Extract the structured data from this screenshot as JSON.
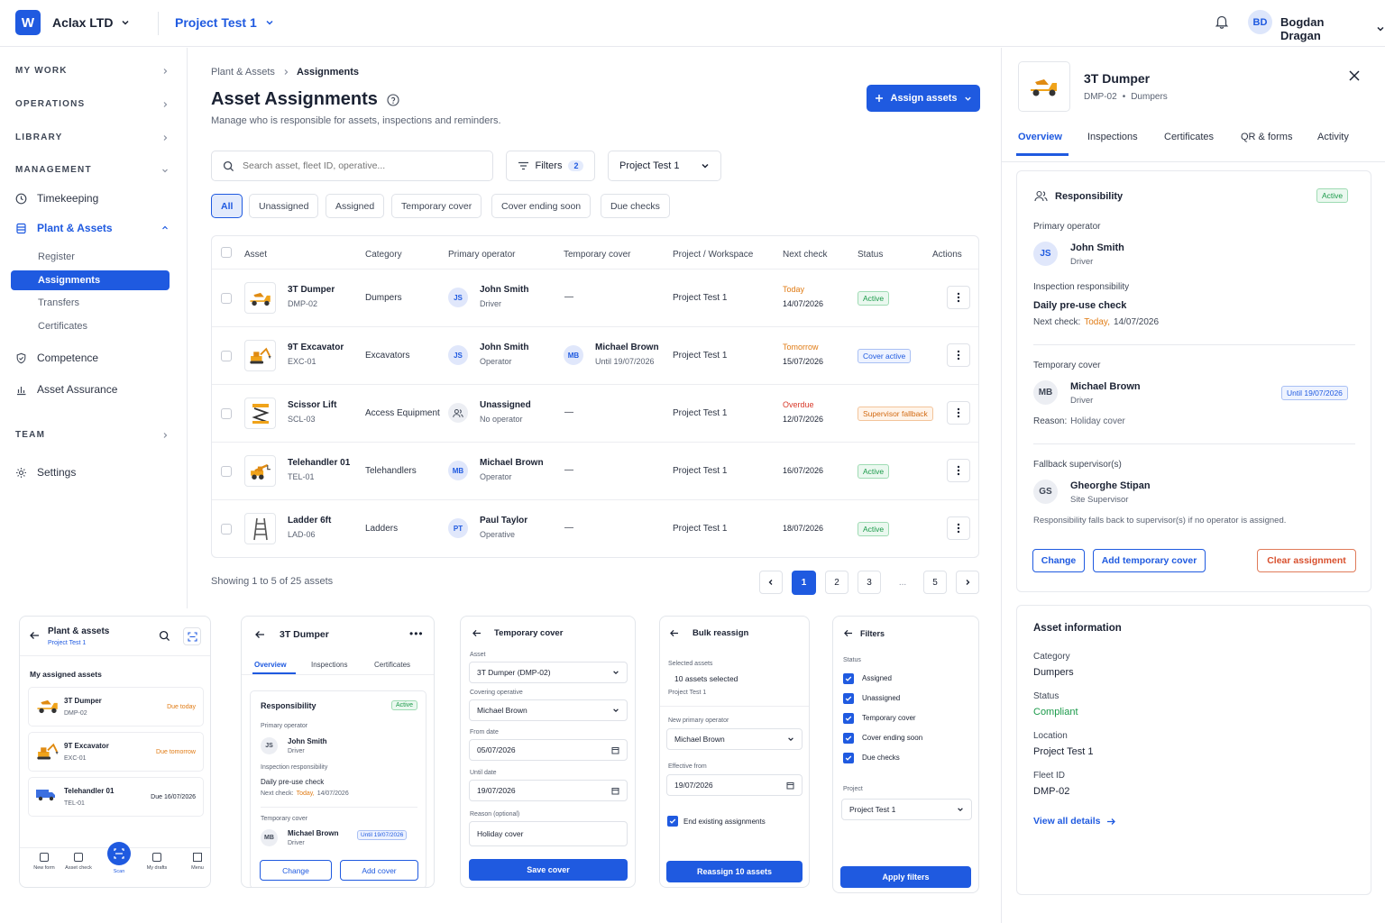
{
  "topbar": {
    "logo": "W",
    "org": "Aclax LTD",
    "project": "Project Test 1",
    "user_initials": "BD",
    "user_name": "Bogdan Dragan"
  },
  "sidebar": {
    "sections": {
      "my_work": "MY WORK",
      "operations": "OPERATIONS",
      "library": "LIBRARY",
      "management": "MANAGEMENT",
      "team": "TEAM"
    },
    "items": {
      "timekeeping": "Timekeeping",
      "plant": "Plant & Assets",
      "competence": "Competence",
      "assurance": "Asset Assurance",
      "settings": "Settings"
    },
    "subs": {
      "register": "Register",
      "assignments": "Assignments",
      "transfers": "Transfers",
      "certificates": "Certificates"
    }
  },
  "main": {
    "breadcrumb": {
      "parent": "Plant & Assets",
      "current": "Assignments"
    },
    "title": "Asset Assignments",
    "subtitle": "Manage who is responsible for assets, inspections and reminders.",
    "assign_btn": "Assign assets",
    "search_placeholder": "Search asset, fleet ID, operative...",
    "filters_label": "Filters",
    "filters_count": "2",
    "project_select": "Project Test 1",
    "chips": [
      "All",
      "Unassigned",
      "Assigned",
      "Temporary cover",
      "Cover ending soon",
      "Due checks"
    ],
    "columns": [
      "Asset",
      "Category",
      "Primary operator",
      "Temporary cover",
      "Project / Workspace",
      "Next check",
      "Status",
      "Actions"
    ],
    "rows": [
      {
        "name": "3T Dumper",
        "id": "DMP-02",
        "icon": "dumper-icon",
        "category": "Dumpers",
        "op_initials": "JS",
        "op_name": "John Smith",
        "op_role": "Driver",
        "cover": "—",
        "cover_initials": "",
        "cover_name": "",
        "cover_until": "",
        "project": "Project Test 1",
        "check_label": "Today",
        "check_color": "#e07b14",
        "check_date": "14/07/2026",
        "status": "Active",
        "status_kind": "green"
      },
      {
        "name": "9T Excavator",
        "id": "EXC-01",
        "icon": "excavator-icon",
        "category": "Excavators",
        "op_initials": "JS",
        "op_name": "John Smith",
        "op_role": "Operator",
        "cover": "",
        "cover_initials": "MB",
        "cover_name": "Michael Brown",
        "cover_until": "Until 19/07/2026",
        "project": "Project Test 1",
        "check_label": "Tomorrow",
        "check_color": "#e07b14",
        "check_date": "15/07/2026",
        "status": "Cover active",
        "status_kind": "blue"
      },
      {
        "name": "Scissor Lift",
        "id": "SCL-03",
        "icon": "scissor-lift-icon",
        "category": "Access Equipment",
        "op_initials": "",
        "op_name": "Unassigned",
        "op_role": "No operator",
        "cover": "—",
        "cover_initials": "",
        "cover_name": "",
        "cover_until": "",
        "project": "Project Test 1",
        "check_label": "Overdue",
        "check_color": "#d83a2a",
        "check_date": "12/07/2026",
        "status": "Supervisor fallback",
        "status_kind": "orange"
      },
      {
        "name": "Telehandler 01",
        "id": "TEL-01",
        "icon": "telehandler-icon",
        "category": "Telehandlers",
        "op_initials": "MB",
        "op_name": "Michael Brown",
        "op_role": "Operator",
        "cover": "—",
        "cover_initials": "",
        "cover_name": "",
        "cover_until": "",
        "project": "Project Test 1",
        "check_label": "",
        "check_color": "#1b2233",
        "check_date": "16/07/2026",
        "status": "Active",
        "status_kind": "green"
      },
      {
        "name": "Ladder 6ft",
        "id": "LAD-06",
        "icon": "ladder-icon",
        "category": "Ladders",
        "op_initials": "PT",
        "op_name": "Paul Taylor",
        "op_role": "Operative",
        "cover": "—",
        "cover_initials": "",
        "cover_name": "",
        "cover_until": "",
        "project": "Project Test 1",
        "check_label": "",
        "check_color": "#1b2233",
        "check_date": "18/07/2026",
        "status": "Active",
        "status_kind": "green"
      }
    ],
    "showing": "Showing 1 to 5 of 25 assets",
    "pages": [
      "1",
      "2",
      "3",
      "...",
      "5"
    ]
  },
  "panel": {
    "title": "3T Dumper",
    "id": "DMP-02",
    "category_line": "Dumpers",
    "tabs": [
      "Overview",
      "Inspections",
      "Certificates",
      "QR & forms",
      "Activity"
    ],
    "responsibility": "Responsibility",
    "status": "Active",
    "primary_label": "Primary operator",
    "primary_initials": "JS",
    "primary_name": "John Smith",
    "primary_role": "Driver",
    "insp_label": "Inspection responsibility",
    "insp_name": "Daily pre-use check",
    "next_check_label": "Next check:",
    "next_check_today": "Today,",
    "next_check_date": "14/07/2026",
    "temp_label": "Temporary cover",
    "temp_initials": "MB",
    "temp_name": "Michael Brown",
    "temp_role": "Driver",
    "temp_until": "Until 19/07/2026",
    "reason_label": "Reason:",
    "reason": "Holiday cover",
    "fallback_label": "Fallback supervisor(s)",
    "fb_initials": "GS",
    "fb_name": "Gheorghe Stipan",
    "fb_role": "Site Supervisor",
    "fb_note": "Responsibility falls back to supervisor(s) if no operator is assigned.",
    "btn_change": "Change",
    "btn_add_cover": "Add temporary cover",
    "btn_clear": "Clear assignment",
    "info_title": "Asset information",
    "info": [
      {
        "label": "Category",
        "value": "Dumpers"
      },
      {
        "label": "Status",
        "value": "Compliant"
      },
      {
        "label": "Location",
        "value": "Project Test 1"
      },
      {
        "label": "Fleet ID",
        "value": "DMP-02"
      }
    ],
    "view_all": "View all details"
  },
  "mobile": {
    "m1": {
      "title": "Plant & assets",
      "project": "Project Test 1",
      "section": "My assigned assets",
      "items": [
        {
          "name": "3T Dumper",
          "id": "DMP-02",
          "due": "Due today"
        },
        {
          "name": "9T Excavator",
          "id": "EXC-01",
          "due": "Due tomorrow"
        },
        {
          "name": "Telehandler 01",
          "id": "TEL-01",
          "due": "Due 16/07/2026"
        }
      ],
      "nav": [
        "New form",
        "Asset check",
        "Scan",
        "My drafts",
        "Menu"
      ]
    },
    "m2": {
      "title": "3T Dumper",
      "tabs": [
        "Overview",
        "Inspections",
        "Certificates"
      ],
      "resp": "Responsibility",
      "status": "Active",
      "primary_label": "Primary operator",
      "initials": "JS",
      "name": "John Smith",
      "role": "Driver",
      "insp_label": "Inspection responsibility",
      "insp": "Daily pre-use check",
      "next": "Next check:",
      "today": "Today,",
      "date": "14/07/2026",
      "temp_label": "Temporary cover",
      "t_initials": "MB",
      "t_name": "Michael Brown",
      "t_role": "Driver",
      "t_until": "Until 19/07/2026",
      "btn_change": "Change",
      "btn_add": "Add cover"
    },
    "m3": {
      "title": "Temporary cover",
      "asset_label": "Asset",
      "asset": "3T Dumper (DMP-02)",
      "op_label": "Covering operative",
      "op": "Michael Brown",
      "from_label": "From date",
      "from": "05/07/2026",
      "until_label": "Until date",
      "until": "19/07/2026",
      "reason_label": "Reason (optional)",
      "reason": "Holiday cover",
      "btn": "Save cover"
    },
    "m4": {
      "title": "Bulk reassign",
      "sel_label": "Selected assets",
      "sel": "10 assets selected",
      "project": "Project Test 1",
      "new_label": "New primary operator",
      "new": "Michael Brown",
      "eff_label": "Effective from",
      "eff": "19/07/2026",
      "end": "End existing assignments",
      "btn": "Reassign 10 assets"
    },
    "m5": {
      "title": "Filters",
      "status_label": "Status",
      "options": [
        "Assigned",
        "Unassigned",
        "Temporary cover",
        "Cover ending soon",
        "Due checks"
      ],
      "project_label": "Project",
      "project": "Project Test 1",
      "btn": "Apply filters"
    }
  },
  "colors": {
    "accent": "#1f5ae0",
    "green": "#1b9a4a",
    "orange": "#e07b14",
    "red": "#d83a2a"
  }
}
